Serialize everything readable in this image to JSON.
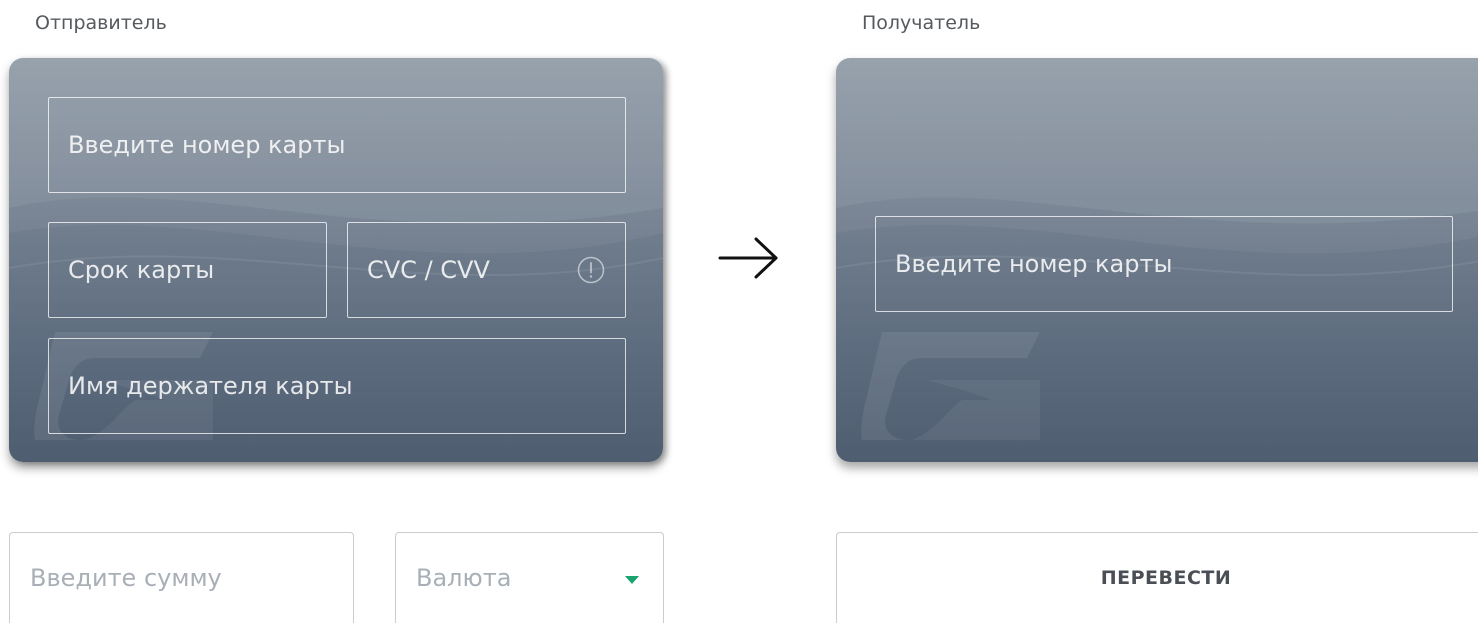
{
  "sender": {
    "label": "Отправитель",
    "card_number_placeholder": "Введите номер карты",
    "expiry_placeholder": "Срок карты",
    "cvc_placeholder": "CVC / CVV",
    "holder_placeholder": "Имя держателя карты"
  },
  "receiver": {
    "label": "Получатель",
    "card_number_placeholder": "Введите номер карты"
  },
  "form": {
    "amount_placeholder": "Введите сумму",
    "currency_placeholder": "Валюта",
    "transfer_label": "ПЕРЕВЕСТИ"
  },
  "icons": {
    "arrow": "arrow-right-icon",
    "info": "info-icon",
    "caret": "chevron-down-icon",
    "watermark": "bank-logo-watermark"
  },
  "colors": {
    "card_top": "#8a96a3",
    "card_bottom": "#4f5d71",
    "caret": "#1aa36f",
    "placeholder": "#a9afb6",
    "button_text": "#4a4f55"
  }
}
